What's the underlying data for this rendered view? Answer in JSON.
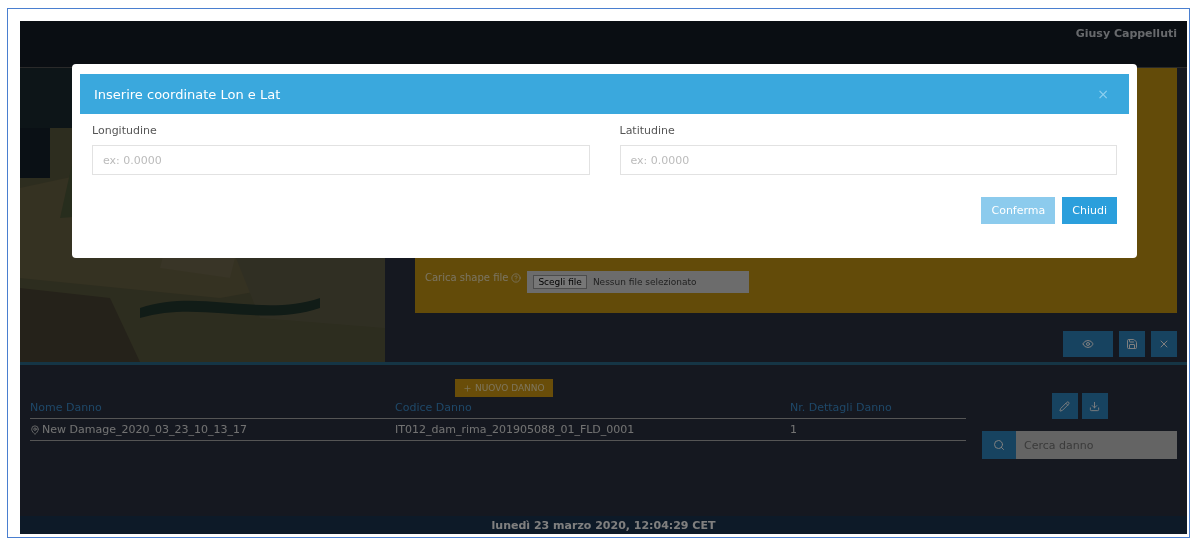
{
  "header": {
    "user_name": "Giusy Cappelluti"
  },
  "upload": {
    "label": "Carica shape file",
    "file_button": "Scegli file",
    "file_status": "Nessun file selezionato"
  },
  "damage_panel": {
    "new_button": "NUOVO DANNO",
    "columns": [
      "Nome Danno",
      "Codice Danno",
      "Nr. Dettagli Danno"
    ],
    "rows": [
      {
        "name": "New Damage_2020_03_23_10_13_17",
        "code": "IT012_dam_rima_201905088_01_FLD_0001",
        "details": "1"
      }
    ],
    "search": {
      "placeholder": "Cerca danno"
    }
  },
  "footer": {
    "datetime": "lunedì 23 marzo 2020, 12:04:29 CET"
  },
  "modal": {
    "title": "Inserire coordinate Lon e Lat",
    "close": "×",
    "fields": [
      {
        "label": "Longitudine",
        "placeholder": "ex: 0.0000"
      },
      {
        "label": "Latitudine",
        "placeholder": "ex: 0.0000"
      }
    ],
    "buttons": [
      {
        "label": "Conferma",
        "disabled": true
      },
      {
        "label": "Chiudi",
        "disabled": false
      }
    ]
  }
}
